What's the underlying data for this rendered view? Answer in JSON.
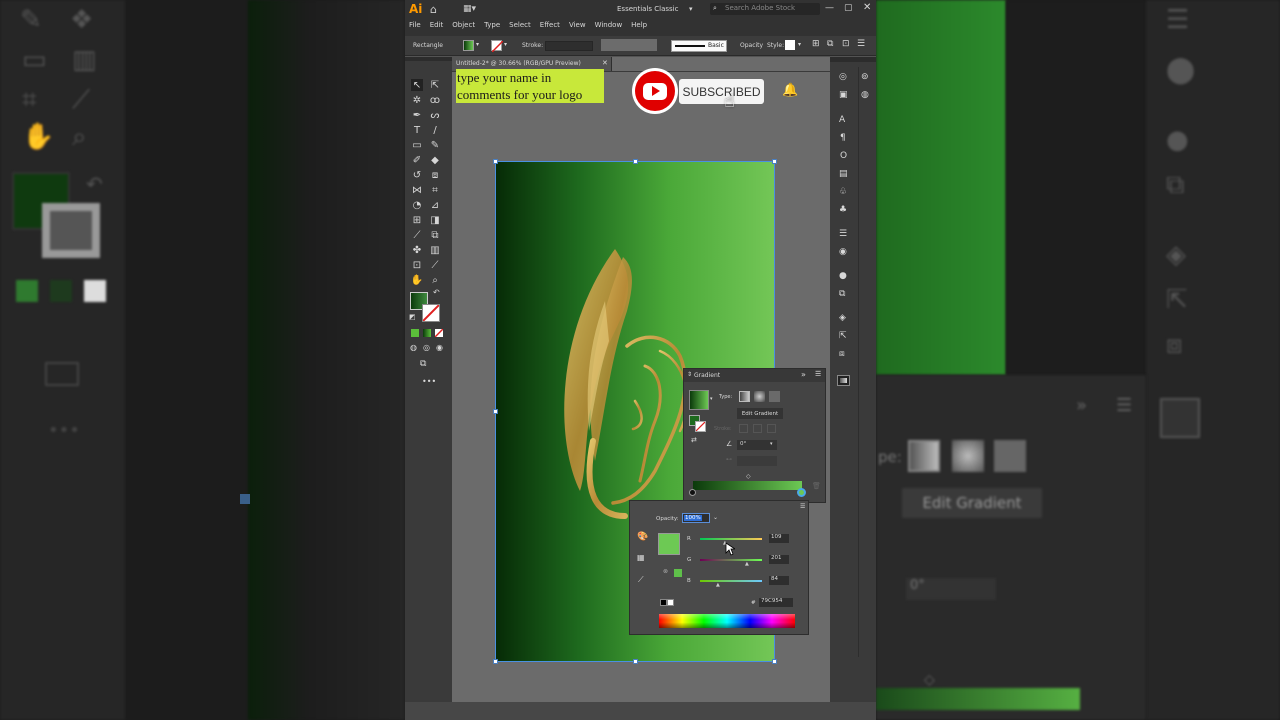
{
  "app": {
    "logo": "Ai",
    "workspace": "Essentials Classic",
    "search_placeholder": "Search Adobe Stock",
    "menu": [
      "File",
      "Edit",
      "Object",
      "Type",
      "Select",
      "Effect",
      "View",
      "Window",
      "Help"
    ],
    "document_tab": "Untitled-2* @ 30.66% (RGB/GPU Preview)"
  },
  "options_bar": {
    "object_type": "Rectangle",
    "stroke_label": "Stroke:",
    "brush_label": "Basic",
    "opacity_label": "Opacity",
    "style_label": "Style:"
  },
  "overlay": {
    "name_prompt_line1": "type your name in",
    "name_prompt_line2": "comments for your logo",
    "subscribe_label": "SUBSCRIBED"
  },
  "gradient_panel": {
    "title": "Gradient",
    "type_label": "Type:",
    "edit_button": "Edit Gradient",
    "stroke_label": "Stroke:",
    "angle_value": "0°"
  },
  "color_picker": {
    "opacity_label": "Opacity:",
    "opacity_value": "100%",
    "r_label": "R",
    "r_value": "109",
    "g_label": "G",
    "g_value": "201",
    "b_label": "B",
    "b_value": "84",
    "hex_label": "#",
    "hex_value": "79C954"
  },
  "right_blur": {
    "edit_gradient": "Edit Gradient",
    "type_fragment": "pe:",
    "angle_value": "0°"
  },
  "colors": {
    "accent_green": "#6dc954",
    "dark_green": "#0b3a0b",
    "highlight_yellow": "#c8e83a",
    "gold": "#c9a24a",
    "youtube_red": "#ff0000"
  }
}
